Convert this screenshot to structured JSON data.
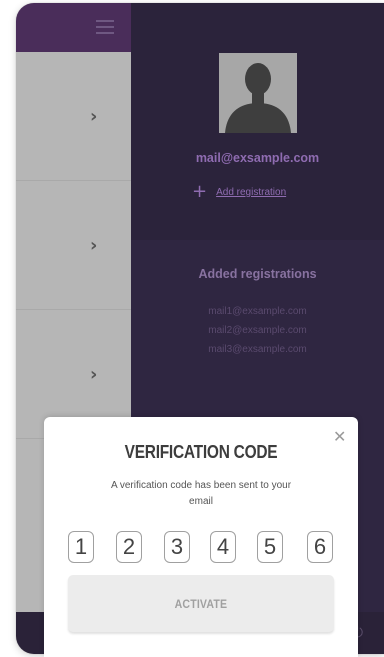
{
  "profile": {
    "email": "mail@exsample.com",
    "add_registration_label": "Add registration"
  },
  "registrations": {
    "title": "Added registrations",
    "items": [
      "mail1@exsample.com",
      "mail2@exsample.com",
      "mail3@exsample.com"
    ]
  },
  "modal": {
    "title": "VERIFICATION CODE",
    "message": "A verification code has been sent to your email",
    "code_digits": [
      "1",
      "2",
      "3",
      "4",
      "5",
      "6"
    ],
    "activate_label": "ACTIVATE"
  },
  "colors": {
    "accent": "#8f6cb1",
    "panel_dark": "#2b233b",
    "menu_header": "#4a2d5a",
    "menu_bg": "#b6b6b6"
  },
  "icons": {
    "menu": "hamburger-icon",
    "chevron": "chevron-right-icon",
    "add": "plus-icon",
    "close": "close-icon",
    "power": "power-icon"
  }
}
